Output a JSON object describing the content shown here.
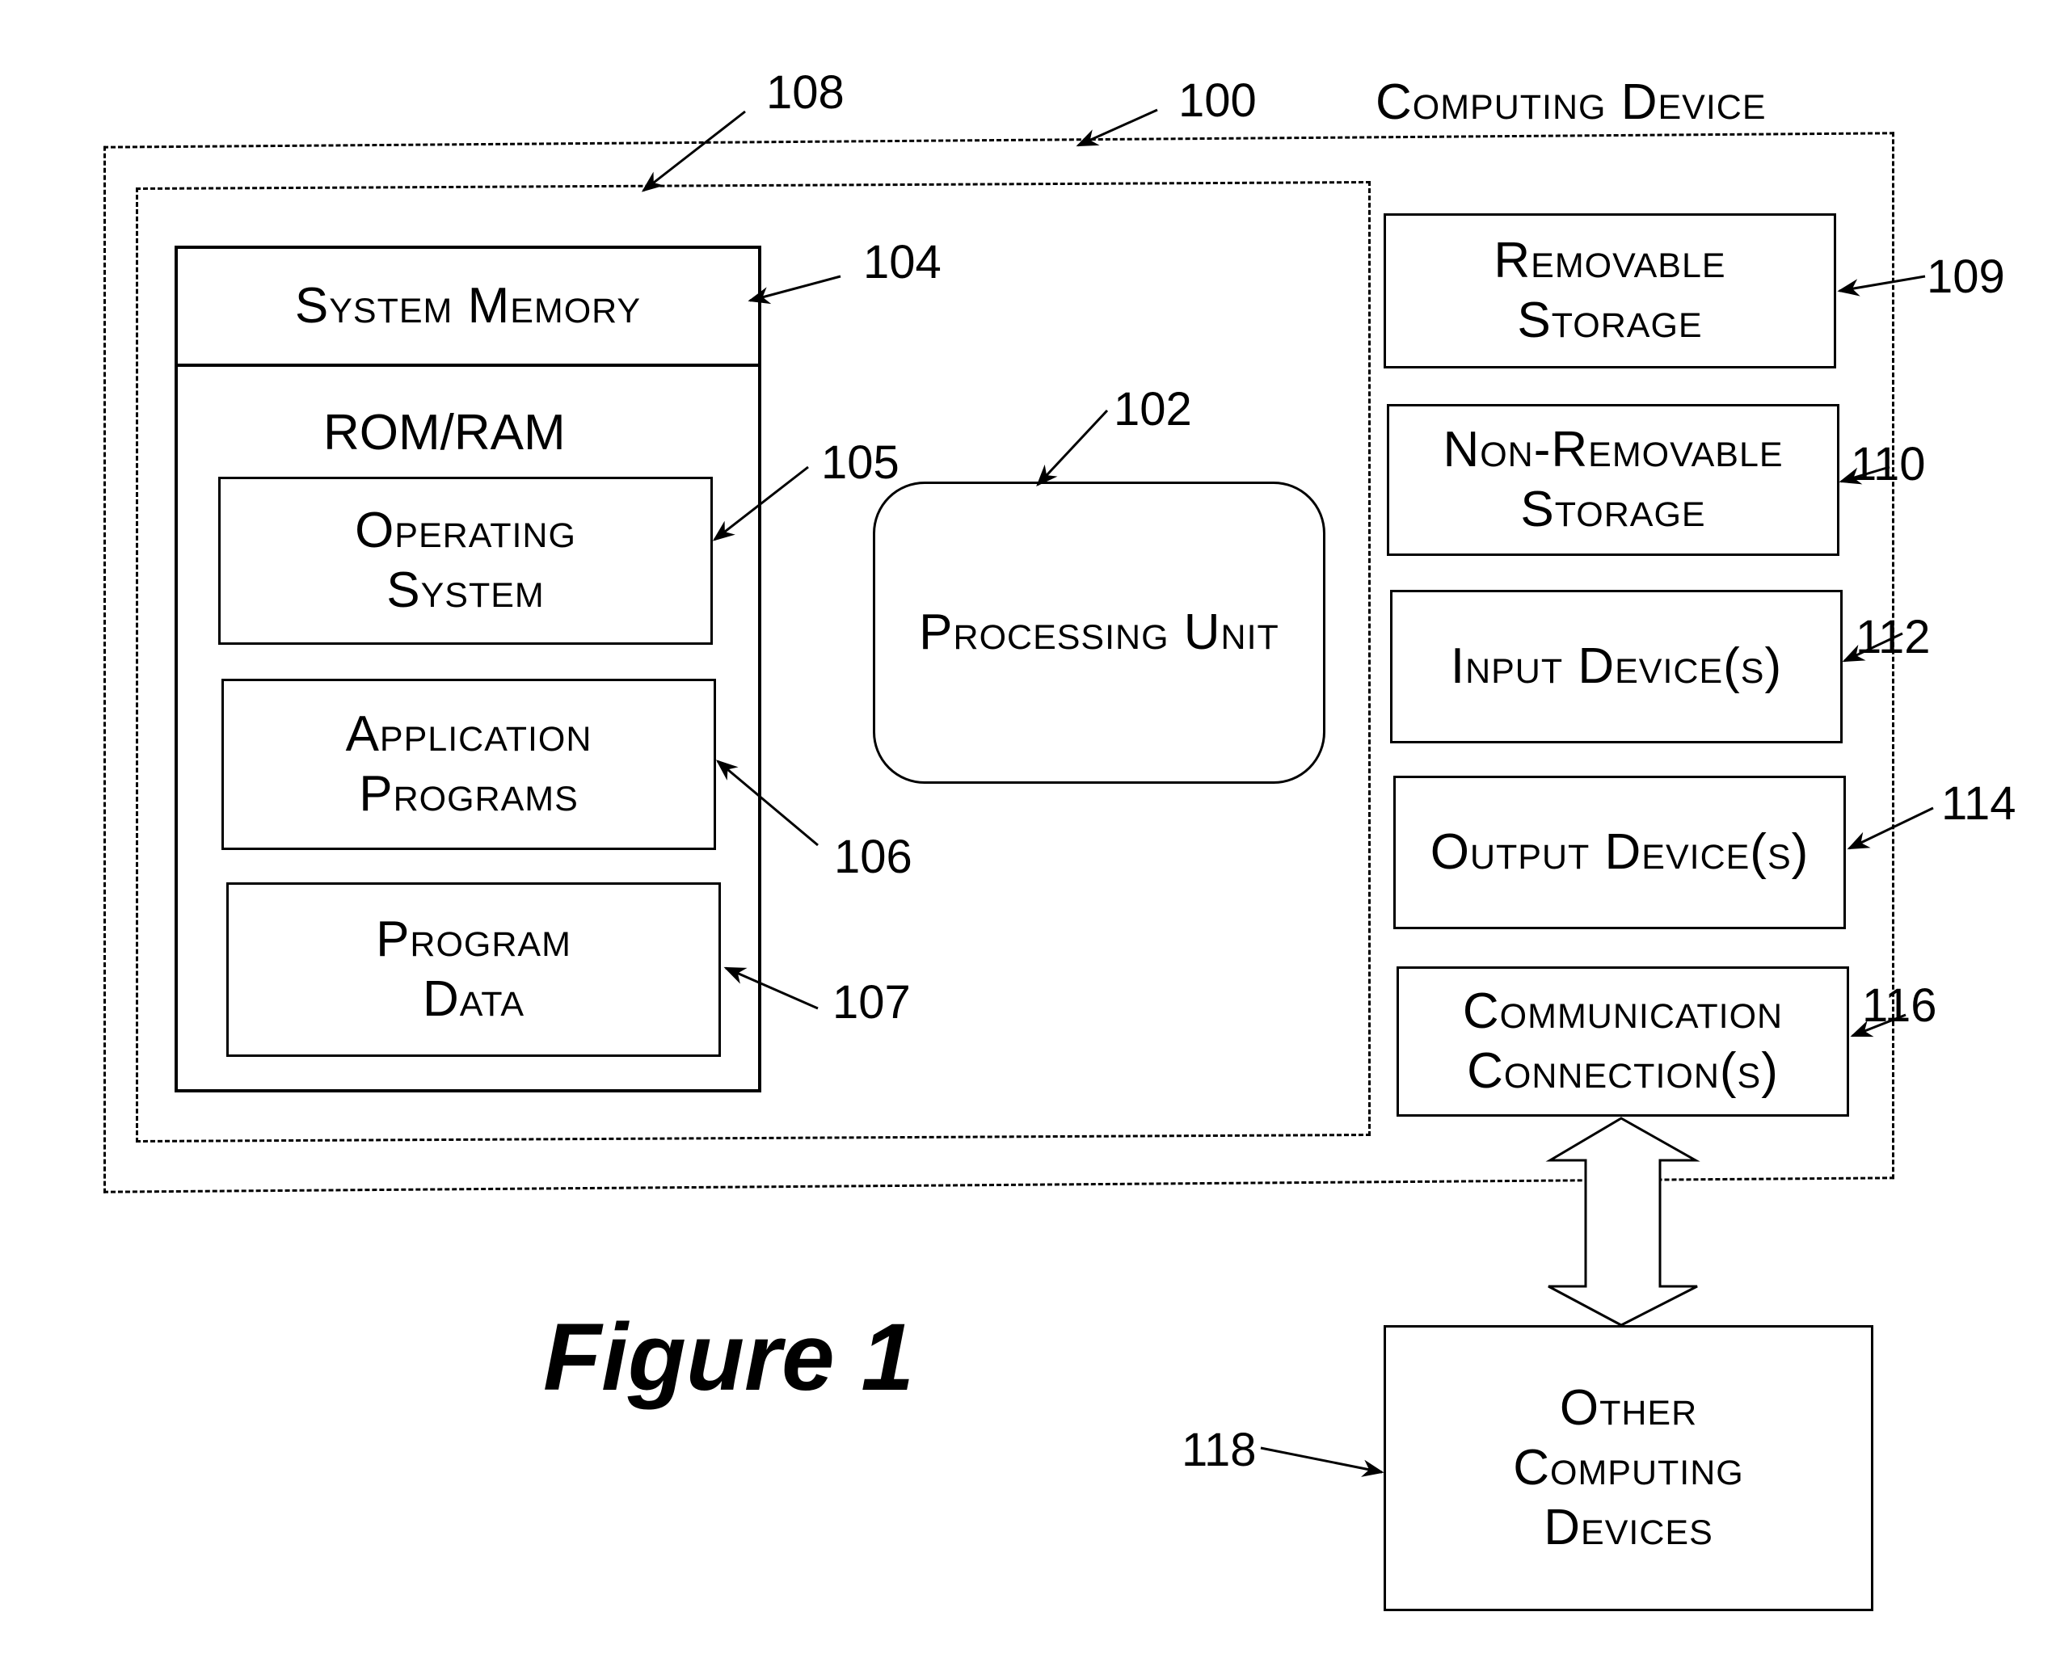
{
  "figure_title": "Figure 1",
  "device_label": "Computing Device",
  "refs": {
    "computing_device": "100",
    "processing_unit": "102",
    "system_memory": "104",
    "operating_system": "105",
    "application_programs": "106",
    "program_data": "107",
    "basic_configuration": "108",
    "removable_storage": "109",
    "non_removable_storage": "110",
    "input_devices": "112",
    "output_devices": "114",
    "communication_connections": "116",
    "other_computing_devices": "118"
  },
  "system_memory": {
    "title": "System Memory",
    "subtitle": "ROM/RAM",
    "items": [
      {
        "line1": "Operating",
        "line2": "System"
      },
      {
        "line1": "Application",
        "line2": "Programs"
      },
      {
        "line1": "Program",
        "line2": "Data"
      }
    ]
  },
  "processing_unit": {
    "label": "Processing Unit"
  },
  "peripherals": [
    {
      "line1": "Removable",
      "line2": "Storage"
    },
    {
      "line1": "Non-Removable",
      "line2": "Storage"
    },
    {
      "line1": "Input Device(s)",
      "line2": ""
    },
    {
      "line1": "Output Device(s)",
      "line2": ""
    },
    {
      "line1": "Communication",
      "line2": "Connection(s)"
    }
  ],
  "other_devices": {
    "line1": "Other",
    "line2": "Computing",
    "line3": "Devices"
  }
}
